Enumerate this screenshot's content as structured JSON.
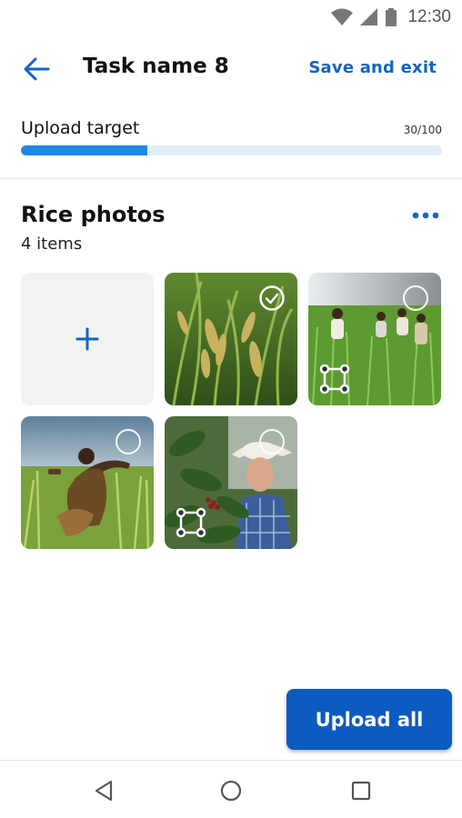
{
  "status_bar": {
    "time": "12:30",
    "icons": [
      "wifi-icon",
      "signal-icon",
      "battery-icon"
    ]
  },
  "app_bar": {
    "back_icon": "arrow-left-icon",
    "title": "Task name 8",
    "save_exit_label": "Save and exit"
  },
  "upload_target": {
    "label": "Upload target",
    "count_text": "30/100",
    "progress": 0.3
  },
  "section": {
    "title": "Rice photos",
    "count": "4 items",
    "more_icon": "more-horizontal-icon"
  },
  "tiles": [
    {
      "kind": "add",
      "icon": "plus-icon"
    },
    {
      "kind": "photo",
      "subject": "rice-panicles",
      "selected": true,
      "frame_icon": false
    },
    {
      "kind": "photo",
      "subject": "people-in-rice-field",
      "selected": false,
      "frame_icon": true
    },
    {
      "kind": "photo",
      "subject": "farmer-in-rice-field",
      "selected": false,
      "frame_icon": false
    },
    {
      "kind": "photo",
      "subject": "man-with-coffee-plant",
      "selected": false,
      "frame_icon": true
    }
  ],
  "upload_all_label": "Upload all",
  "nav": {
    "icons": [
      "back-triangle-icon",
      "home-circle-icon",
      "recents-square-icon"
    ]
  },
  "colors": {
    "accent": "#1565c0",
    "button": "#0b5bc0",
    "progress_fill": "#1e88e5",
    "progress_track": "#e3eef9"
  }
}
